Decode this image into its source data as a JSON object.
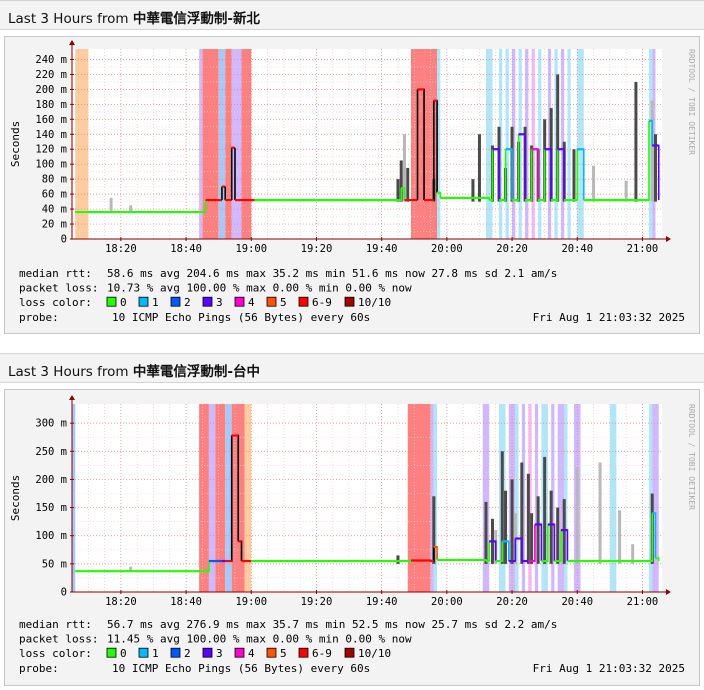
{
  "headers": [
    {
      "prefix": "Last 3 Hours from ",
      "bold": "中華電信浮動制-新北"
    },
    {
      "prefix": "Last 3 Hours from ",
      "bold": "中華電信浮動制-台中"
    }
  ],
  "watermark": "RRDTOOL / TOBI OETIKER",
  "colors": {
    "loss_0": "#26ff00",
    "loss_1": "#00b8ff",
    "loss_2": "#0059ff",
    "loss_3": "#5e00ff",
    "loss_4": "#ff00d0",
    "loss_5": "#ff5400",
    "loss_69": "#ff0000",
    "loss_1010": "#a10000",
    "band_orange": "#ffcca0",
    "band_red": "#ff8080",
    "band_cyan": "#b0e6f8",
    "band_violet": "#d0b8ff",
    "band_magenta": "#f8b6ee",
    "band_blue": "#a8c8f8",
    "smoke_dark": "#4a4a4a",
    "smoke_light": "#b8b8b8",
    "median_black": "#000000",
    "grid_minor": "#e8c0c0",
    "axis": "#880000"
  },
  "legend": {
    "loss_label": "loss color:",
    "items": [
      {
        "label": "0",
        "color": "#26ff00"
      },
      {
        "label": "1",
        "color": "#00b8ff"
      },
      {
        "label": "2",
        "color": "#0059ff"
      },
      {
        "label": "3",
        "color": "#5e00ff"
      },
      {
        "label": "4",
        "color": "#ff00d0"
      },
      {
        "label": "5",
        "color": "#ff5400"
      },
      {
        "label": "6-9",
        "color": "#ff0000"
      },
      {
        "label": "10/10",
        "color": "#a10000"
      }
    ]
  },
  "chart_data": [
    {
      "type": "area",
      "title": "",
      "ylabel": "Seconds",
      "x_tick_labels": [
        "18:20",
        "18:40",
        "19:00",
        "19:20",
        "19:40",
        "20:00",
        "20:20",
        "20:40",
        "21:00"
      ],
      "y_ticks": [
        {
          "v": 0,
          "label": "0"
        },
        {
          "v": 20,
          "label": "20 m"
        },
        {
          "v": 40,
          "label": "40 m"
        },
        {
          "v": 60,
          "label": "60 m"
        },
        {
          "v": 80,
          "label": "80 m"
        },
        {
          "v": 100,
          "label": "100 m"
        },
        {
          "v": 120,
          "label": "120 m"
        },
        {
          "v": 140,
          "label": "140 m"
        },
        {
          "v": 160,
          "label": "160 m"
        },
        {
          "v": 180,
          "label": "180 m"
        },
        {
          "v": 200,
          "label": "200 m"
        },
        {
          "v": 220,
          "label": "220 m"
        },
        {
          "v": 240,
          "label": "240 m"
        }
      ],
      "ylim_ms": [
        0,
        254
      ],
      "xlim_min": [
        -15,
        166
      ],
      "loss_bands": [
        {
          "from": -14,
          "to": -10,
          "color": "band_orange"
        },
        {
          "from": 24,
          "to": 25,
          "color": "band_violet"
        },
        {
          "from": 25,
          "to": 30,
          "color": "band_red"
        },
        {
          "from": 30,
          "to": 32,
          "color": "band_blue"
        },
        {
          "from": 32,
          "to": 34,
          "color": "band_red"
        },
        {
          "from": 34,
          "to": 37,
          "color": "band_violet"
        },
        {
          "from": 37,
          "to": 40,
          "color": "band_red"
        },
        {
          "from": 89,
          "to": 93,
          "color": "band_red"
        },
        {
          "from": 93,
          "to": 97,
          "color": "band_red"
        },
        {
          "from": 97,
          "to": 98,
          "color": "band_cyan"
        },
        {
          "from": 112,
          "to": 114,
          "color": "band_cyan"
        },
        {
          "from": 116,
          "to": 117,
          "color": "band_cyan"
        },
        {
          "from": 118,
          "to": 119,
          "color": "band_cyan"
        },
        {
          "from": 120,
          "to": 121,
          "color": "band_violet"
        },
        {
          "from": 122,
          "to": 123,
          "color": "band_cyan"
        },
        {
          "from": 124,
          "to": 125,
          "color": "band_violet"
        },
        {
          "from": 126,
          "to": 127,
          "color": "band_magenta"
        },
        {
          "from": 128,
          "to": 129,
          "color": "band_cyan"
        },
        {
          "from": 131,
          "to": 132,
          "color": "band_violet"
        },
        {
          "from": 133,
          "to": 134,
          "color": "band_cyan"
        },
        {
          "from": 135,
          "to": 136,
          "color": "band_violet"
        },
        {
          "from": 137,
          "to": 138,
          "color": "band_cyan"
        },
        {
          "from": 140,
          "to": 142,
          "color": "band_cyan"
        },
        {
          "from": 162,
          "to": 163,
          "color": "band_cyan"
        },
        {
          "from": 163,
          "to": 164,
          "color": "band_violet"
        }
      ],
      "smoke": [
        {
          "t": -3,
          "lo": 35,
          "hi": 55,
          "shade": "light"
        },
        {
          "t": 3,
          "lo": 35,
          "hi": 45,
          "shade": "light"
        },
        {
          "t": 85,
          "lo": 50,
          "hi": 80,
          "shade": "dark"
        },
        {
          "t": 86,
          "lo": 50,
          "hi": 105,
          "shade": "dark"
        },
        {
          "t": 87,
          "lo": 50,
          "hi": 140,
          "shade": "light"
        },
        {
          "t": 88,
          "lo": 50,
          "hi": 95,
          "shade": "dark"
        },
        {
          "t": 96,
          "lo": 50,
          "hi": 80,
          "shade": "dark"
        },
        {
          "t": 108,
          "lo": 50,
          "hi": 80,
          "shade": "dark"
        },
        {
          "t": 110,
          "lo": 50,
          "hi": 140,
          "shade": "dark"
        },
        {
          "t": 114,
          "lo": 50,
          "hi": 125,
          "shade": "dark"
        },
        {
          "t": 116,
          "lo": 50,
          "hi": 150,
          "shade": "dark"
        },
        {
          "t": 118,
          "lo": 50,
          "hi": 95,
          "shade": "dark"
        },
        {
          "t": 120,
          "lo": 50,
          "hi": 150,
          "shade": "dark"
        },
        {
          "t": 122,
          "lo": 50,
          "hi": 130,
          "shade": "dark"
        },
        {
          "t": 124,
          "lo": 50,
          "hi": 150,
          "shade": "dark"
        },
        {
          "t": 126,
          "lo": 50,
          "hi": 125,
          "shade": "dark"
        },
        {
          "t": 128,
          "lo": 50,
          "hi": 120,
          "shade": "dark"
        },
        {
          "t": 130,
          "lo": 50,
          "hi": 160,
          "shade": "dark"
        },
        {
          "t": 132,
          "lo": 50,
          "hi": 175,
          "shade": "dark"
        },
        {
          "t": 134,
          "lo": 50,
          "hi": 220,
          "shade": "dark"
        },
        {
          "t": 136,
          "lo": 50,
          "hi": 130,
          "shade": "dark"
        },
        {
          "t": 139,
          "lo": 50,
          "hi": 120,
          "shade": "dark"
        },
        {
          "t": 145,
          "lo": 50,
          "hi": 98,
          "shade": "light"
        },
        {
          "t": 155,
          "lo": 50,
          "hi": 78,
          "shade": "light"
        },
        {
          "t": 158,
          "lo": 50,
          "hi": 210,
          "shade": "dark"
        },
        {
          "t": 163,
          "lo": 50,
          "hi": 185,
          "shade": "light"
        },
        {
          "t": 164,
          "lo": 50,
          "hi": 140,
          "shade": "dark"
        }
      ],
      "median": [
        [
          -14,
          36,
          "loss_0"
        ],
        [
          26,
          36,
          "loss_0"
        ],
        [
          26,
          52,
          "loss_69"
        ],
        [
          31,
          52,
          "loss_69"
        ],
        [
          31,
          70,
          "loss_69"
        ],
        [
          32,
          70,
          "loss_69"
        ],
        [
          32,
          52,
          "loss_69"
        ],
        [
          34,
          52,
          "loss_69"
        ],
        [
          34,
          122,
          "loss_69"
        ],
        [
          35,
          122,
          "loss_69"
        ],
        [
          35,
          52,
          "loss_69"
        ],
        [
          41,
          52,
          "loss_0"
        ],
        [
          85,
          52,
          "loss_0"
        ],
        [
          86,
          68,
          "loss_0"
        ],
        [
          87,
          52,
          "loss_69"
        ],
        [
          91,
          52,
          "loss_69"
        ],
        [
          91,
          200,
          "loss_69"
        ],
        [
          92,
          200,
          "loss_69"
        ],
        [
          93,
          52,
          "loss_69"
        ],
        [
          96,
          185,
          "loss_69"
        ],
        [
          97,
          62,
          "loss_0"
        ],
        [
          98,
          55,
          "loss_0"
        ],
        [
          113,
          52,
          "loss_0"
        ],
        [
          114,
          120,
          "loss_3"
        ],
        [
          116,
          52,
          "loss_0"
        ],
        [
          118,
          120,
          "loss_1"
        ],
        [
          120,
          52,
          "loss_0"
        ],
        [
          122,
          140,
          "loss_3"
        ],
        [
          124,
          52,
          "loss_0"
        ],
        [
          126,
          120,
          "loss_4"
        ],
        [
          128,
          52,
          "loss_0"
        ],
        [
          130,
          120,
          "loss_3"
        ],
        [
          132,
          52,
          "loss_0"
        ],
        [
          134,
          120,
          "loss_3"
        ],
        [
          136,
          52,
          "loss_0"
        ],
        [
          140,
          120,
          "loss_1"
        ],
        [
          142,
          52,
          "loss_0"
        ],
        [
          158,
          52,
          "loss_0"
        ],
        [
          162,
          158,
          "loss_1"
        ],
        [
          163,
          125,
          "loss_3"
        ],
        [
          165,
          52,
          "loss_0"
        ]
      ],
      "stats": [
        {
          "label": "median rtt:",
          "text": "58.6 ms avg  204.6 ms max   35.2 ms min   51.6 ms now   27.8 ms sd   2.1   am/s"
        },
        {
          "label": "packet loss:",
          "text": "10.73 % avg  100.00 % max   0.00 % min   0.00 % now"
        }
      ],
      "probe_label": "probe:",
      "probe": "10 ICMP Echo Pings (56 Bytes) every 60s",
      "date": "Fri Aug  1 21:03:32 2025"
    },
    {
      "type": "area",
      "title": "",
      "ylabel": "Seconds",
      "x_tick_labels": [
        "18:20",
        "18:40",
        "19:00",
        "19:20",
        "19:40",
        "20:00",
        "20:20",
        "20:40",
        "21:00"
      ],
      "y_ticks": [
        {
          "v": 0,
          "label": "0"
        },
        {
          "v": 50,
          "label": "50 m"
        },
        {
          "v": 100,
          "label": "100 m"
        },
        {
          "v": 150,
          "label": "150 m"
        },
        {
          "v": 200,
          "label": "200 m"
        },
        {
          "v": 250,
          "label": "250 m"
        },
        {
          "v": 300,
          "label": "300 m"
        }
      ],
      "ylim_ms": [
        0,
        334
      ],
      "xlim_min": [
        -15,
        166
      ],
      "loss_bands": [
        {
          "from": -15,
          "to": -14,
          "color": "band_blue"
        },
        {
          "from": 24,
          "to": 27,
          "color": "band_red"
        },
        {
          "from": 27,
          "to": 29,
          "color": "band_violet"
        },
        {
          "from": 29,
          "to": 32,
          "color": "band_red"
        },
        {
          "from": 32,
          "to": 34,
          "color": "band_blue"
        },
        {
          "from": 34,
          "to": 38,
          "color": "band_red"
        },
        {
          "from": 38,
          "to": 40,
          "color": "band_orange"
        },
        {
          "from": 88,
          "to": 95,
          "color": "band_red"
        },
        {
          "from": 95,
          "to": 96,
          "color": "band_violet"
        },
        {
          "from": 96,
          "to": 97,
          "color": "band_cyan"
        },
        {
          "from": 111,
          "to": 113,
          "color": "band_violet"
        },
        {
          "from": 116,
          "to": 118,
          "color": "band_cyan"
        },
        {
          "from": 119,
          "to": 121,
          "color": "band_violet"
        },
        {
          "from": 121,
          "to": 122,
          "color": "band_cyan"
        },
        {
          "from": 123,
          "to": 124,
          "color": "band_violet"
        },
        {
          "from": 125,
          "to": 126,
          "color": "band_magenta"
        },
        {
          "from": 127,
          "to": 128,
          "color": "band_violet"
        },
        {
          "from": 129,
          "to": 131,
          "color": "band_cyan"
        },
        {
          "from": 132,
          "to": 133,
          "color": "band_violet"
        },
        {
          "from": 134,
          "to": 136,
          "color": "band_violet"
        },
        {
          "from": 136,
          "to": 137,
          "color": "band_cyan"
        },
        {
          "from": 139,
          "to": 141,
          "color": "band_violet"
        },
        {
          "from": 150,
          "to": 152,
          "color": "band_cyan"
        },
        {
          "from": 162,
          "to": 163,
          "color": "band_cyan"
        },
        {
          "from": 163,
          "to": 165,
          "color": "band_violet"
        }
      ],
      "smoke": [
        {
          "t": 3,
          "lo": 36,
          "hi": 45,
          "shade": "light"
        },
        {
          "t": 85,
          "lo": 50,
          "hi": 65,
          "shade": "dark"
        },
        {
          "t": 96,
          "lo": 50,
          "hi": 170,
          "shade": "dark"
        },
        {
          "t": 112,
          "lo": 50,
          "hi": 160,
          "shade": "dark"
        },
        {
          "t": 114,
          "lo": 50,
          "hi": 130,
          "shade": "dark"
        },
        {
          "t": 115,
          "lo": 50,
          "hi": 110,
          "shade": "light"
        },
        {
          "t": 117,
          "lo": 50,
          "hi": 250,
          "shade": "dark"
        },
        {
          "t": 118,
          "lo": 50,
          "hi": 180,
          "shade": "dark"
        },
        {
          "t": 120,
          "lo": 50,
          "hi": 200,
          "shade": "dark"
        },
        {
          "t": 121,
          "lo": 50,
          "hi": 140,
          "shade": "light"
        },
        {
          "t": 123,
          "lo": 50,
          "hi": 230,
          "shade": "dark"
        },
        {
          "t": 125,
          "lo": 50,
          "hi": 210,
          "shade": "dark"
        },
        {
          "t": 126,
          "lo": 50,
          "hi": 140,
          "shade": "dark"
        },
        {
          "t": 128,
          "lo": 50,
          "hi": 170,
          "shade": "dark"
        },
        {
          "t": 130,
          "lo": 50,
          "hi": 240,
          "shade": "dark"
        },
        {
          "t": 132,
          "lo": 50,
          "hi": 180,
          "shade": "dark"
        },
        {
          "t": 134,
          "lo": 50,
          "hi": 150,
          "shade": "dark"
        },
        {
          "t": 136,
          "lo": 50,
          "hi": 165,
          "shade": "dark"
        },
        {
          "t": 140,
          "lo": 50,
          "hi": 220,
          "shade": "light"
        },
        {
          "t": 147,
          "lo": 50,
          "hi": 230,
          "shade": "light"
        },
        {
          "t": 153,
          "lo": 50,
          "hi": 145,
          "shade": "light"
        },
        {
          "t": 157,
          "lo": 50,
          "hi": 85,
          "shade": "light"
        },
        {
          "t": 163,
          "lo": 50,
          "hi": 175,
          "shade": "dark"
        }
      ],
      "median": [
        [
          -14,
          37,
          "loss_0"
        ],
        [
          26,
          37,
          "loss_0"
        ],
        [
          27,
          55,
          "loss_2"
        ],
        [
          31,
          55,
          "loss_3"
        ],
        [
          32,
          55,
          "loss_69"
        ],
        [
          34,
          278,
          "loss_69"
        ],
        [
          36,
          90,
          "loss_69"
        ],
        [
          37,
          55,
          "loss_69"
        ],
        [
          40,
          55,
          "loss_0"
        ],
        [
          88,
          55,
          "loss_0"
        ],
        [
          89,
          56,
          "loss_69"
        ],
        [
          95,
          55,
          "loss_69"
        ],
        [
          96,
          80,
          "loss_5"
        ],
        [
          97,
          57,
          "loss_0"
        ],
        [
          112,
          55,
          "loss_0"
        ],
        [
          113,
          90,
          "loss_3"
        ],
        [
          115,
          55,
          "loss_0"
        ],
        [
          117,
          90,
          "loss_1"
        ],
        [
          119,
          55,
          "loss_3"
        ],
        [
          121,
          95,
          "loss_3"
        ],
        [
          123,
          55,
          "loss_3"
        ],
        [
          125,
          55,
          "loss_4"
        ],
        [
          127,
          120,
          "loss_3"
        ],
        [
          129,
          55,
          "loss_0"
        ],
        [
          131,
          120,
          "loss_3"
        ],
        [
          133,
          55,
          "loss_0"
        ],
        [
          135,
          110,
          "loss_3"
        ],
        [
          137,
          55,
          "loss_0"
        ],
        [
          152,
          55,
          "loss_0"
        ],
        [
          163,
          140,
          "loss_1"
        ],
        [
          164,
          60,
          "loss_0"
        ],
        [
          165,
          55,
          "loss_0"
        ]
      ],
      "stats": [
        {
          "label": "median rtt:",
          "text": "56.7 ms avg  276.9 ms max   35.7 ms min   52.5 ms now   25.7 ms sd   2.2    am/s"
        },
        {
          "label": "packet loss:",
          "text": "11.45 % avg  100.00 % max   0.00 % min   0.00 % now"
        }
      ],
      "probe_label": "probe:",
      "probe": "10 ICMP Echo Pings (56 Bytes) every 60s",
      "date": "Fri Aug  1 21:03:32 2025"
    }
  ]
}
